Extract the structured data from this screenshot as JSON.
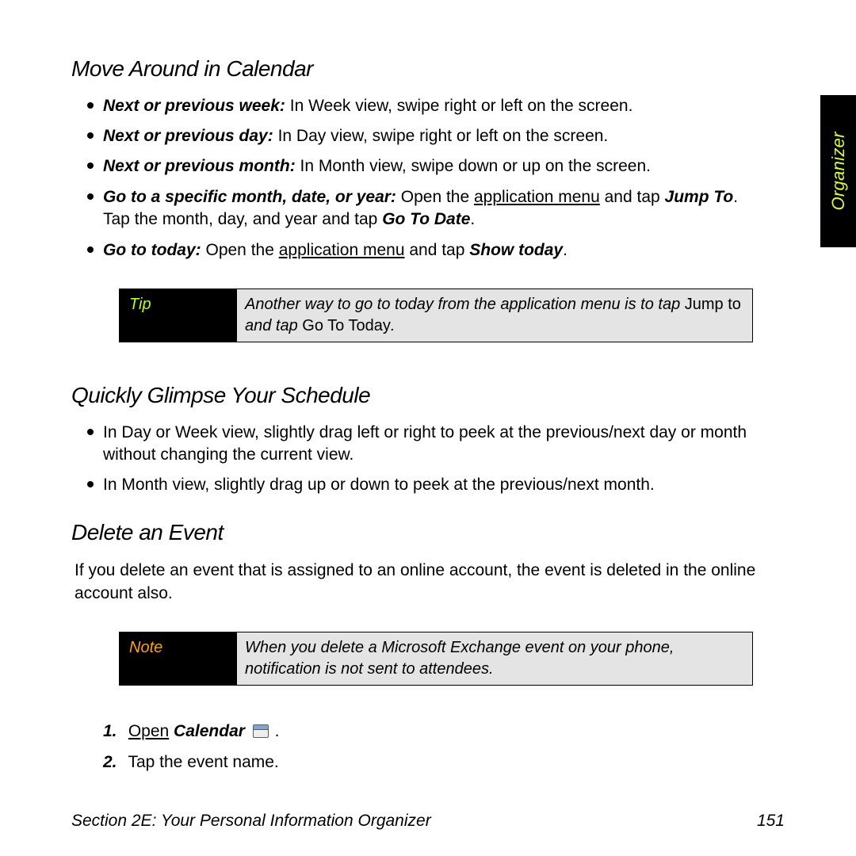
{
  "sidebar": {
    "label": "Organizer"
  },
  "sections": {
    "move": {
      "heading": "Move Around in Calendar",
      "items": [
        {
          "lead": "Next or previous week:",
          "tail": " In Week view, swipe right or left on the screen."
        },
        {
          "lead": "Next or previous day:",
          "tail": " In Day view, swipe right or left on the screen."
        },
        {
          "lead": "Next or previous month:",
          "tail": " In Month view, swipe down or up on the screen."
        },
        {
          "lead": "Go to a specific month, date, or year:",
          "p1": " Open the ",
          "link": "application menu",
          "p2": " and tap ",
          "action": "Jump To",
          "p3": ". Tap the month, day, and year and tap ",
          "action2": "Go To Date",
          "p4": "."
        },
        {
          "lead": "Go to today:",
          "p1": " Open the ",
          "link": "application menu",
          "p2": " and tap ",
          "action": "Show today",
          "p3": "."
        }
      ],
      "tip_label": "Tip",
      "tip_body_a": "Another way to go to today from the application menu is to tap ",
      "tip_body_b": "Jump to",
      "tip_body_c": " and tap ",
      "tip_body_d": "Go To Today",
      "tip_body_e": "."
    },
    "glimpse": {
      "heading": "Quickly Glimpse Your Schedule",
      "items": [
        "In Day or Week view, slightly drag left or right to peek at the previous/next day or month without changing the current view.",
        "In Month view, slightly drag up or down to peek at the previous/next month."
      ]
    },
    "delete": {
      "heading": "Delete an Event",
      "intro": "If you delete an event that is assigned to an online account, the event is deleted in the online account also.",
      "note_label": "Note",
      "note_body": "When you delete a Microsoft Exchange event on your phone, notification is not sent to attendees.",
      "steps": [
        {
          "num": "1.",
          "text_a": "Open",
          "text_b": " Calendar",
          "text_c": " ."
        },
        {
          "num": "2.",
          "text": "Tap the event name."
        }
      ]
    }
  },
  "footer": {
    "left": "Section 2E: Your Personal Information Organizer",
    "right": "151"
  }
}
